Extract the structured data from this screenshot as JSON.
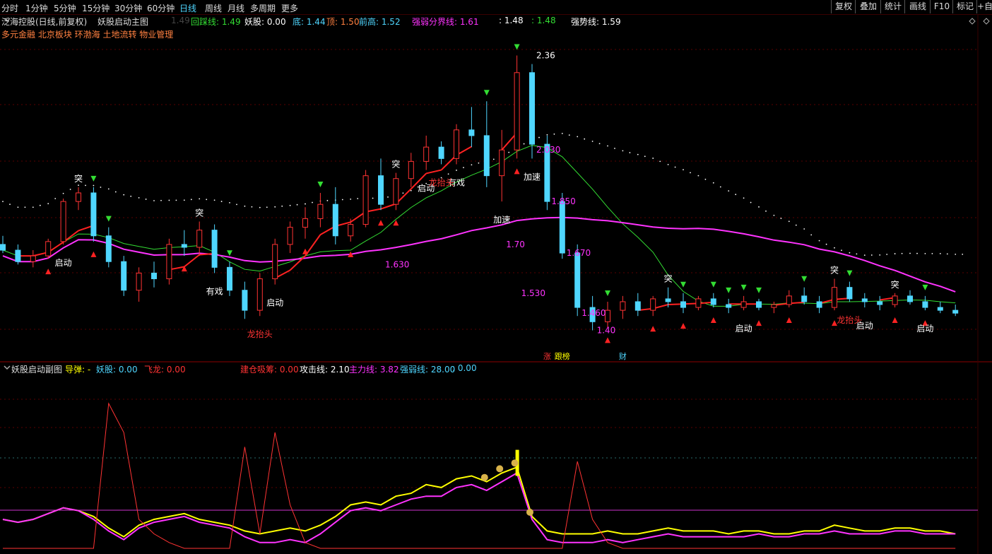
{
  "tabs": [
    "分时",
    "1分钟",
    "5分钟",
    "15分钟",
    "30分钟",
    "60分钟",
    "日线",
    "周线",
    "月线",
    "多周期",
    "更多"
  ],
  "active_tab": "日线",
  "toolbar": [
    "复权",
    "叠加",
    "统计",
    "画线",
    "F10",
    "标记",
    "+自"
  ],
  "main_header": {
    "stock": "泛海控股(日线,前复权)",
    "indicator": "妖股启动主图",
    "hidden_value": "1.49",
    "items": [
      {
        "label": "回踩线",
        "value": "1.49",
        "color": "#33dd33"
      },
      {
        "label": "妖股",
        "value": "0.00",
        "color": "#ffffff"
      },
      {
        "label": "底",
        "value": "1.44",
        "color": "#4fd6ff"
      },
      {
        "label": "顶",
        "value": "1.50",
        "color": "#ff8040"
      },
      {
        "label": "前高",
        "value": "1.52",
        "color": "#4fd6ff"
      },
      {
        "label": "强弱分界线",
        "value": "1.61",
        "color": "#ff33ff"
      },
      {
        "label": "",
        "value": "1.48",
        "color": "#ffffff"
      },
      {
        "label": "",
        "value": "1.48",
        "color": "#33dd33"
      },
      {
        "label": "强势线",
        "value": "1.59",
        "color": "#ffffff"
      }
    ],
    "concepts": "多元金融 北京板块 环渤海 土地流转 物业管理"
  },
  "sub_header": {
    "indicator": "妖股启动副图",
    "items": [
      {
        "label": "导弹",
        "value": "-",
        "color": "#ffff00"
      },
      {
        "label": "妖股",
        "value": "0.00",
        "color": "#4fd6ff"
      },
      {
        "label": "飞龙",
        "value": "0.00",
        "color": "#ff3333"
      },
      {
        "label": "建仓吸筹",
        "value": "0.00",
        "color": "#ff3333"
      },
      {
        "label": "攻击线",
        "value": "2.10",
        "color": "#ffffff"
      },
      {
        "label": "主力线",
        "value": "3.82",
        "color": "#ff33ff"
      },
      {
        "label": "强弱线",
        "value": "28.00",
        "color": "#4fd6ff"
      },
      {
        "label": "",
        "value": "0.00",
        "color": "#4fd6ff"
      }
    ]
  },
  "price_labels": [
    {
      "text": "2.36",
      "i": 35
    },
    {
      "text": "2.030",
      "i": 35
    },
    {
      "text": "1.850",
      "i": 36
    },
    {
      "text": "1.670",
      "i": 37
    },
    {
      "text": "1.460",
      "i": 38
    },
    {
      "text": "1.40",
      "i": 39
    },
    {
      "text": "1.70",
      "i": 33
    },
    {
      "text": "1.530",
      "i": 34
    },
    {
      "text": "1.630",
      "i": 25
    }
  ],
  "event_labels": [
    {
      "text": "启动",
      "i": 4,
      "color": "#ffffff"
    },
    {
      "text": "有戏",
      "i": 14,
      "color": "#ffffff"
    },
    {
      "text": "龙抬头",
      "i": 17,
      "color": "#ff3333"
    },
    {
      "text": "启动",
      "i": 18,
      "color": "#ffffff"
    },
    {
      "text": "突",
      "i": 5,
      "color": "#ffffff"
    },
    {
      "text": "突",
      "i": 13,
      "color": "#ffffff"
    },
    {
      "text": "突",
      "i": 26,
      "color": "#ffffff"
    },
    {
      "text": "有戏",
      "i": 30,
      "color": "#ffffff"
    },
    {
      "text": "龙抬头",
      "i": 29,
      "color": "#ff3333"
    },
    {
      "text": "启动",
      "i": 28,
      "color": "#ffffff"
    },
    {
      "text": "加速",
      "i": 33,
      "color": "#ffffff"
    },
    {
      "text": "加速",
      "i": 35,
      "color": "#ffffff"
    },
    {
      "text": "突",
      "i": 44,
      "color": "#ffffff"
    },
    {
      "text": "启动",
      "i": 49,
      "color": "#ffffff"
    },
    {
      "text": "龙抬头",
      "i": 56,
      "color": "#ff3333"
    },
    {
      "text": "启动",
      "i": 57,
      "color": "#ffffff"
    },
    {
      "text": "突",
      "i": 55,
      "color": "#ffffff"
    },
    {
      "text": "突",
      "i": 59,
      "color": "#ffffff"
    },
    {
      "text": "启动",
      "i": 61,
      "color": "#ffffff"
    }
  ],
  "bottom_tags": [
    {
      "text": "涨",
      "color": "#ff3333",
      "i": 36
    },
    {
      "text": "跟榜",
      "color": "#ffff00",
      "i": 37
    },
    {
      "text": "财",
      "color": "#4fd6ff",
      "i": 41
    }
  ],
  "chart_data": [
    {
      "type": "candlestick",
      "name": "main",
      "ylim": [
        1.3,
        2.45
      ],
      "candles": [
        [
          1.7,
          1.73,
          1.67,
          1.68
        ],
        [
          1.68,
          1.7,
          1.63,
          1.64
        ],
        [
          1.64,
          1.68,
          1.62,
          1.66
        ],
        [
          1.66,
          1.72,
          1.65,
          1.71
        ],
        [
          1.71,
          1.86,
          1.7,
          1.85
        ],
        [
          1.85,
          1.9,
          1.82,
          1.88
        ],
        [
          1.88,
          1.9,
          1.71,
          1.73
        ],
        [
          1.73,
          1.76,
          1.62,
          1.64
        ],
        [
          1.64,
          1.66,
          1.52,
          1.54
        ],
        [
          1.54,
          1.62,
          1.5,
          1.6
        ],
        [
          1.6,
          1.64,
          1.55,
          1.58
        ],
        [
          1.58,
          1.72,
          1.56,
          1.7
        ],
        [
          1.7,
          1.75,
          1.66,
          1.69
        ],
        [
          1.69,
          1.78,
          1.66,
          1.75
        ],
        [
          1.75,
          1.77,
          1.6,
          1.62
        ],
        [
          1.62,
          1.64,
          1.52,
          1.54
        ],
        [
          1.54,
          1.57,
          1.44,
          1.47
        ],
        [
          1.47,
          1.6,
          1.45,
          1.58
        ],
        [
          1.58,
          1.72,
          1.56,
          1.7
        ],
        [
          1.7,
          1.78,
          1.67,
          1.76
        ],
        [
          1.76,
          1.83,
          1.72,
          1.79
        ],
        [
          1.79,
          1.88,
          1.76,
          1.84
        ],
        [
          1.84,
          1.9,
          1.7,
          1.73
        ],
        [
          1.73,
          1.79,
          1.71,
          1.77
        ],
        [
          1.77,
          1.96,
          1.76,
          1.94
        ],
        [
          1.94,
          2.0,
          1.82,
          1.84
        ],
        [
          1.84,
          1.95,
          1.82,
          1.93
        ],
        [
          1.93,
          2.02,
          1.9,
          1.99
        ],
        [
          1.99,
          2.08,
          1.96,
          2.04
        ],
        [
          2.04,
          2.06,
          1.98,
          2.0
        ],
        [
          2.0,
          2.12,
          1.98,
          2.1
        ],
        [
          2.1,
          2.18,
          2.04,
          2.08
        ],
        [
          2.08,
          2.2,
          1.9,
          1.94
        ],
        [
          1.94,
          2.1,
          1.85,
          2.03
        ],
        [
          2.03,
          2.36,
          2.0,
          2.3
        ],
        [
          2.3,
          2.33,
          2.0,
          2.05
        ],
        [
          2.05,
          2.08,
          1.82,
          1.85
        ],
        [
          1.85,
          1.88,
          1.65,
          1.67
        ],
        [
          1.67,
          1.7,
          1.45,
          1.48
        ],
        [
          1.48,
          1.52,
          1.4,
          1.43
        ],
        [
          1.43,
          1.5,
          1.41,
          1.47
        ],
        [
          1.47,
          1.52,
          1.44,
          1.5
        ],
        [
          1.5,
          1.53,
          1.45,
          1.47
        ],
        [
          1.47,
          1.52,
          1.45,
          1.51
        ],
        [
          1.51,
          1.55,
          1.48,
          1.5
        ],
        [
          1.5,
          1.53,
          1.46,
          1.48
        ],
        [
          1.48,
          1.52,
          1.47,
          1.51
        ],
        [
          1.51,
          1.53,
          1.48,
          1.49
        ],
        [
          1.49,
          1.51,
          1.46,
          1.48
        ],
        [
          1.48,
          1.52,
          1.47,
          1.5
        ],
        [
          1.5,
          1.51,
          1.47,
          1.48
        ],
        [
          1.48,
          1.5,
          1.46,
          1.49
        ],
        [
          1.49,
          1.54,
          1.48,
          1.52
        ],
        [
          1.52,
          1.55,
          1.49,
          1.5
        ],
        [
          1.5,
          1.52,
          1.46,
          1.48
        ],
        [
          1.48,
          1.58,
          1.47,
          1.55
        ],
        [
          1.55,
          1.57,
          1.5,
          1.51
        ],
        [
          1.51,
          1.53,
          1.48,
          1.5
        ],
        [
          1.5,
          1.52,
          1.47,
          1.49
        ],
        [
          1.49,
          1.53,
          1.48,
          1.52
        ],
        [
          1.52,
          1.54,
          1.49,
          1.5
        ],
        [
          1.5,
          1.52,
          1.47,
          1.48
        ],
        [
          1.48,
          1.5,
          1.46,
          1.47
        ],
        [
          1.47,
          1.49,
          1.45,
          1.46
        ]
      ]
    },
    {
      "type": "line",
      "name": "sub",
      "ylim": [
        0,
        60
      ],
      "series": [
        {
          "name": "攻击线",
          "color": "#ffff00",
          "values": [
            10,
            9,
            10,
            12,
            14,
            13,
            11,
            7,
            4,
            8,
            10,
            11,
            12,
            10,
            9,
            8,
            6,
            5,
            6,
            7,
            6,
            8,
            11,
            15,
            16,
            15,
            18,
            19,
            22,
            21,
            24,
            25,
            23,
            26,
            28,
            11,
            6,
            5,
            5,
            5,
            6,
            5,
            5,
            6,
            7,
            6,
            6,
            6,
            5,
            6,
            6,
            5,
            5,
            6,
            6,
            8,
            7,
            6,
            6,
            7,
            7,
            6,
            6,
            5
          ]
        },
        {
          "name": "主力线",
          "color": "#ff33ff",
          "values": [
            10,
            9,
            10,
            12,
            14,
            13,
            10,
            6,
            3,
            7,
            9,
            10,
            11,
            9,
            8,
            7,
            4,
            2,
            2,
            3,
            2,
            5,
            9,
            13,
            14,
            13,
            15,
            17,
            18,
            18,
            21,
            22,
            20,
            23,
            26,
            10,
            3,
            2,
            2,
            2,
            3,
            2,
            3,
            4,
            5,
            4,
            4,
            4,
            4,
            4,
            5,
            4,
            4,
            5,
            5,
            6,
            5,
            5,
            5,
            6,
            6,
            5,
            5,
            5
          ]
        },
        {
          "name": "飞龙",
          "color": "#ff3333",
          "values": [
            0,
            0,
            0,
            0,
            0,
            0,
            0,
            50,
            40,
            10,
            5,
            2,
            0,
            0,
            0,
            0,
            35,
            5,
            40,
            15,
            2,
            0,
            0,
            0,
            0,
            0,
            0,
            0,
            0,
            0,
            0,
            0,
            0,
            0,
            0,
            0,
            0,
            0,
            30,
            10,
            2,
            0,
            0,
            0,
            0,
            0,
            0,
            0,
            0,
            0,
            0,
            0,
            0,
            0,
            0,
            0,
            0,
            0,
            0,
            0,
            0,
            0,
            0,
            0
          ]
        }
      ]
    }
  ]
}
